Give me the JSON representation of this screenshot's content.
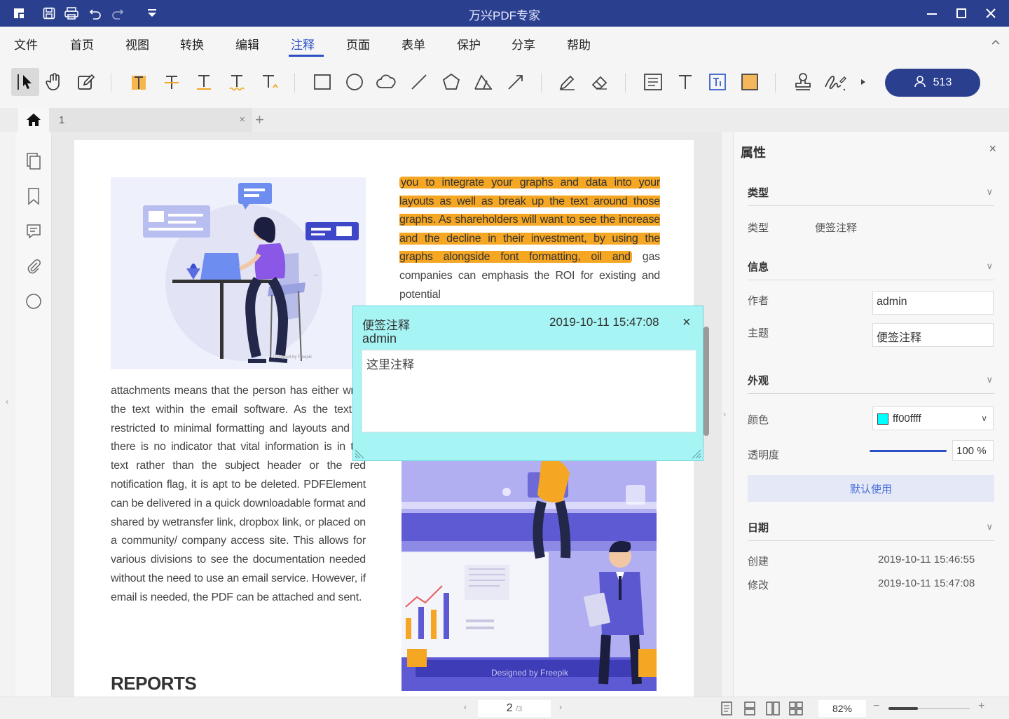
{
  "app": {
    "title": "万兴PDF专家"
  },
  "menu": {
    "items": [
      "文件",
      "首页",
      "视图",
      "转换",
      "编辑",
      "注释",
      "页面",
      "表单",
      "保护",
      "分享",
      "帮助"
    ],
    "active": "注释"
  },
  "user_button": {
    "label": "513",
    "icon": "user-icon"
  },
  "tabs": {
    "doc_tab": "1",
    "close": "×",
    "add": "+"
  },
  "document": {
    "left_text": "attachments means that the person has either write the text within the email software. As the text is restricted to minimal formatting and layouts and as there is no indicator that vital information is in the text rather than the subject header or the red notification flag, it is apt to be deleted. PDFElement can be delivered in a quick downloadable format and shared by wetransfer link, dropbox link, or placed on a community/ company access site. This allows for various divisions to see the documentation needed without the need to use an email service. However, if email is needed, the PDF can be attached and sent.",
    "heading": "REPORTS",
    "right_highlighted": "you to integrate your graphs and data into your layouts as well as break up the text around those graphs. As shareholders will want to see the increase and the decline in their investment, by using the graphs alongside font formatting, oil and",
    "right_rest_1": " gas companies can",
    "right_rest_2": "emphasis the ROI for existing and potential",
    "illus1_credit": "Designed by Freepik",
    "illus2_credit": "Designed by Freepik"
  },
  "sticky_note": {
    "title": "便签注释",
    "timestamp": "2019-10-11 15:47:08",
    "author": "admin",
    "content": "这里注释",
    "close": "×"
  },
  "properties": {
    "title": "属性",
    "close": "×",
    "sections": {
      "type": {
        "heading": "类型",
        "label": "类型",
        "value": "便签注释"
      },
      "info": {
        "heading": "信息",
        "author_label": "作者",
        "author_value": "admin",
        "subject_label": "主题",
        "subject_value": "便签注释"
      },
      "appearance": {
        "heading": "外观",
        "color_label": "颜色",
        "color_value": "ff00ffff",
        "opacity_label": "透明度",
        "opacity_value": "100 %",
        "default_button": "默认使用"
      },
      "date": {
        "heading": "日期",
        "created_label": "创建",
        "created_value": "2019-10-11 15:46:55",
        "modified_label": "修改",
        "modified_value": "2019-10-11 15:47:08"
      }
    }
  },
  "status": {
    "page_current": "2",
    "page_total": "/3",
    "zoom": "82%",
    "zoom_minus": "−",
    "zoom_plus": "+"
  },
  "colors": {
    "brand": "#2b3f8f",
    "accent": "#2b4fc5",
    "highlight": "#f5a623",
    "note_bg": "#a6f4f4",
    "note_color_swatch": "#00ffff"
  }
}
